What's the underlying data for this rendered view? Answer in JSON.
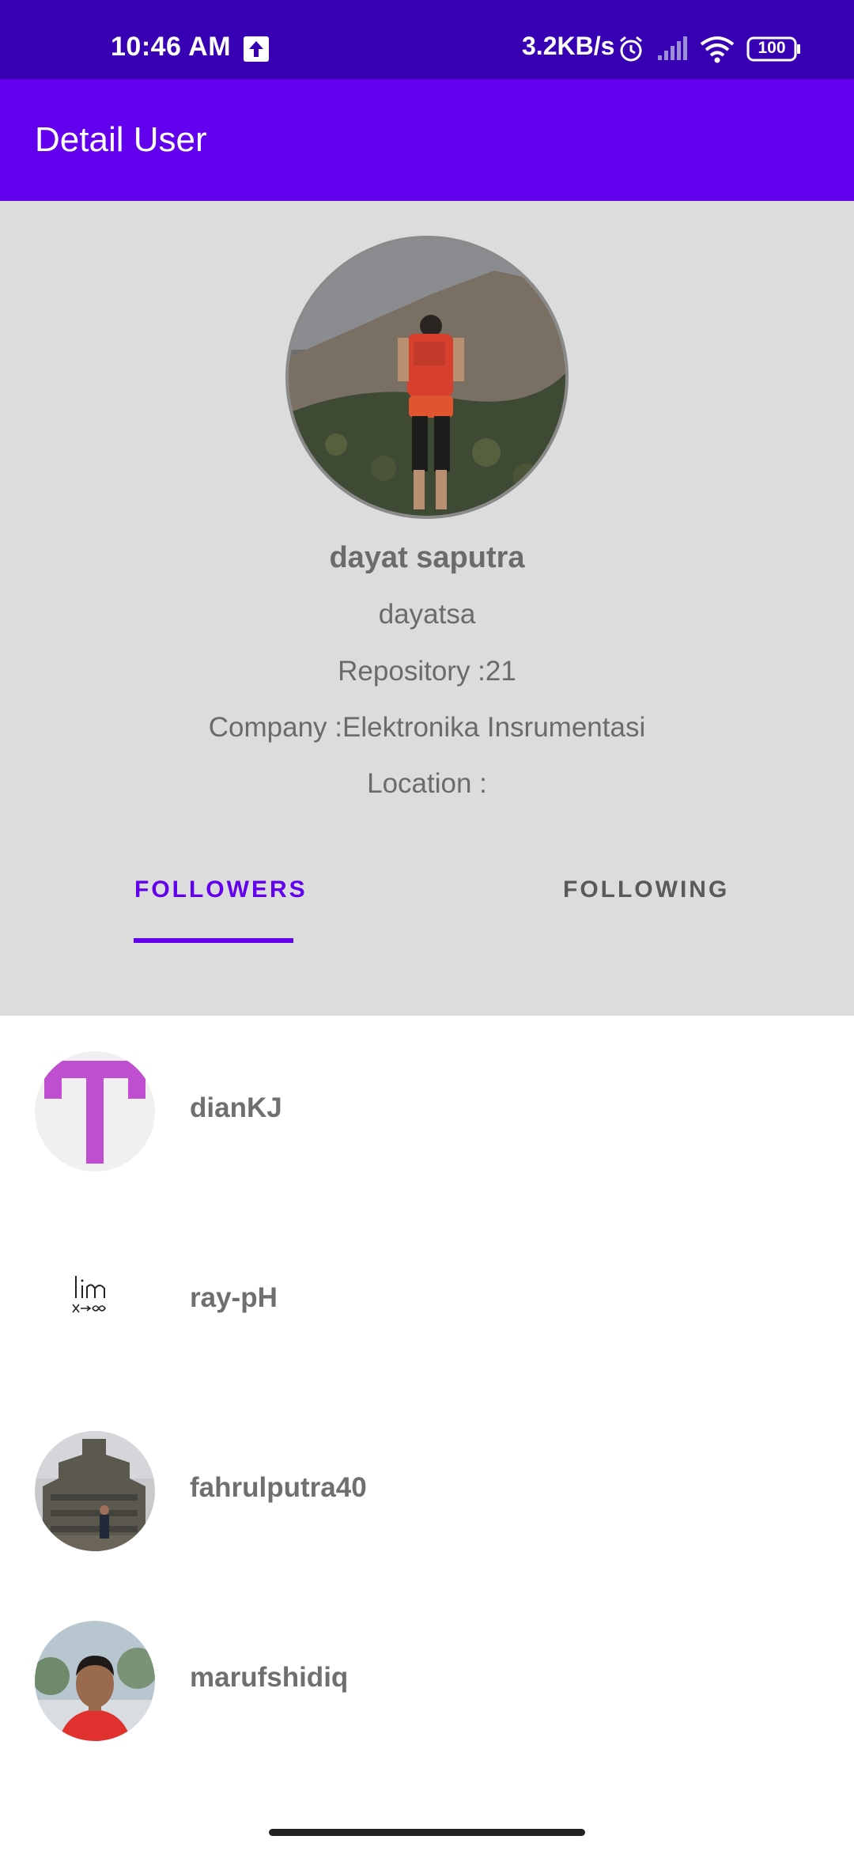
{
  "status_bar": {
    "time": "10:46 AM",
    "network_speed": "3.2KB/s",
    "battery_level": "100",
    "icons": [
      "upload-icon",
      "alarm-icon",
      "signal-icon",
      "wifi-icon",
      "battery-icon"
    ]
  },
  "app_bar": {
    "title": "Detail User",
    "background_color": "#6200EE"
  },
  "profile": {
    "name": "dayat saputra",
    "username": "dayatsa",
    "repository": "Repository :21",
    "company": "Company :Elektronika Insrumentasi",
    "location": "Location :"
  },
  "tabs": [
    {
      "label": "FOLLOWERS",
      "selected": true
    },
    {
      "label": "FOLLOWING",
      "selected": false
    }
  ],
  "followers": [
    {
      "username": "dianKJ"
    },
    {
      "username": "ray-pH"
    },
    {
      "username": "fahrulputra40"
    },
    {
      "username": "marufshidiq"
    }
  ],
  "colors": {
    "status_bar": "#3700B3",
    "accent": "#6200EE",
    "header_background": "#DCDCDC",
    "text_secondary": "#6B6B6B"
  }
}
